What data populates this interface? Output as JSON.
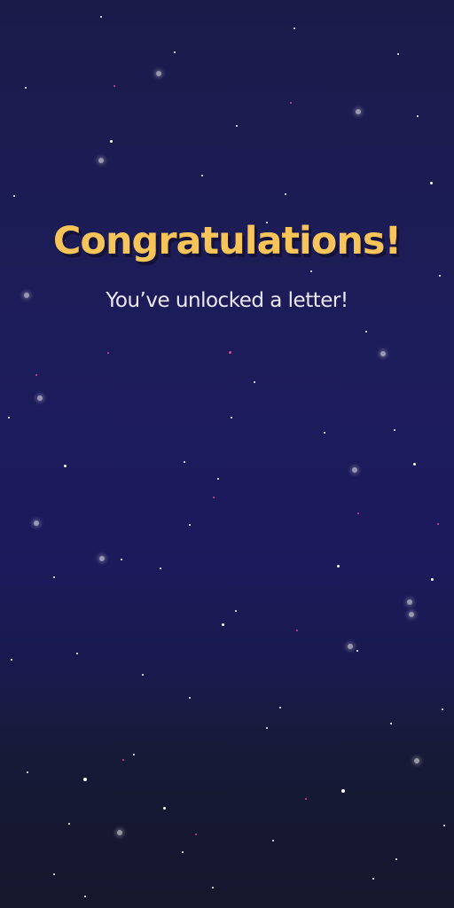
{
  "reward_screen": {
    "title": "Congratulations!",
    "subtitle": "You’ve unlocked a letter!"
  },
  "colors": {
    "title": "#f7c45a",
    "title_shadow": "#14123a",
    "subtitle": "#e8e9f4",
    "sky_top": "#1b1b4a",
    "sky_bottom": "#15172c"
  }
}
